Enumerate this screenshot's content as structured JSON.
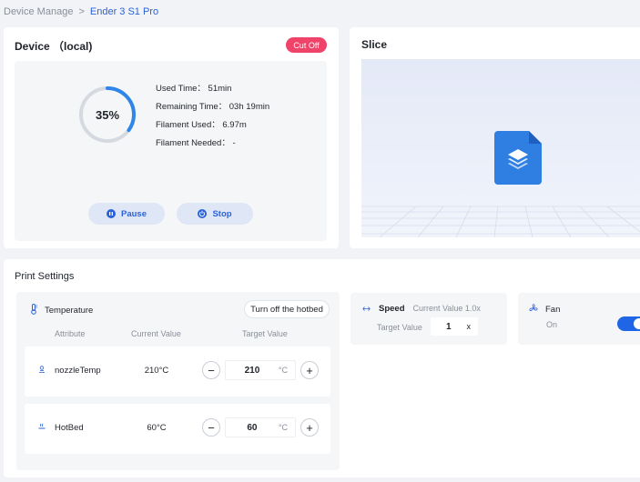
{
  "breadcrumb": {
    "parent": "Device Manage",
    "separator": ">",
    "current": "Ender 3 S1 Pro"
  },
  "device": {
    "title": "Device （local)",
    "cut_off_label": "Cut Off",
    "progress_label": "35%",
    "progress": 0.35,
    "used_time": "Used Time：  51min",
    "remaining_time": "Remaining Time：  03h 19min",
    "filament_used": "Filament Used：  6.97m",
    "filament_needed": "Filament Needed：  -",
    "pause_label": "Pause",
    "stop_label": "Stop"
  },
  "slice": {
    "title": "Slice"
  },
  "settings": {
    "title": "Print Settings",
    "temperature": {
      "title": "Temperature",
      "hotbed_button": "Turn off the hotbed",
      "col_attribute": "Attribute",
      "col_current": "Current Value",
      "col_target": "Target Value",
      "rows": [
        {
          "name": "nozzleTemp",
          "current": "210°C",
          "target": "210",
          "unit": "°C",
          "minus": "−",
          "plus": "+"
        },
        {
          "name": "HotBed",
          "current": "60°C",
          "target": "60",
          "unit": "°C",
          "minus": "−",
          "plus": "+"
        }
      ]
    },
    "speed": {
      "label": "Speed",
      "current": "Current Value 1.0x",
      "target_label": "Target Value",
      "target": "1",
      "unit": "x"
    },
    "fan": {
      "label": "Fan",
      "state": "On",
      "on": true
    }
  },
  "colors": {
    "accent": "#2b62d9",
    "danger": "#f0436a",
    "toggle": "#1f66e6",
    "slice_icon": "#2f7fe3"
  },
  "icons": [
    "chevron-right-icon",
    "pause-icon",
    "power-icon",
    "file-layers-icon",
    "thermometer-icon",
    "nozzle-icon",
    "hotbed-icon",
    "speed-icon",
    "fan-icon"
  ]
}
